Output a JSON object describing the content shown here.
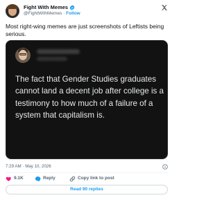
{
  "account": {
    "display_name": "Fight With Memes",
    "handle": "@FightWithMemes",
    "separator": "·",
    "follow_label": "Follow"
  },
  "tweet": {
    "text": "Most right-wing memes are just screenshots of Leftists being serious."
  },
  "media": {
    "quote_text": "The fact that Gender Studies graduates cannot land a decent job after college is a testimony to how much of a failure of a system that capitalism is."
  },
  "meta": {
    "timestamp": "7:29 AM · May 10, 2026"
  },
  "actions": {
    "like_count": "9.1K",
    "reply_label": "Reply",
    "copy_label": "Copy link to post"
  },
  "replies_button": {
    "label": "Read 90 replies"
  },
  "colors": {
    "accent": "#1d9bf0",
    "like": "#f91880",
    "text": "#0f1419",
    "muted": "#536471",
    "media_bg": "#121212"
  },
  "icons": [
    "x-logo-icon",
    "verified-badge-icon",
    "info-icon",
    "heart-icon",
    "reply-icon",
    "link-icon"
  ]
}
